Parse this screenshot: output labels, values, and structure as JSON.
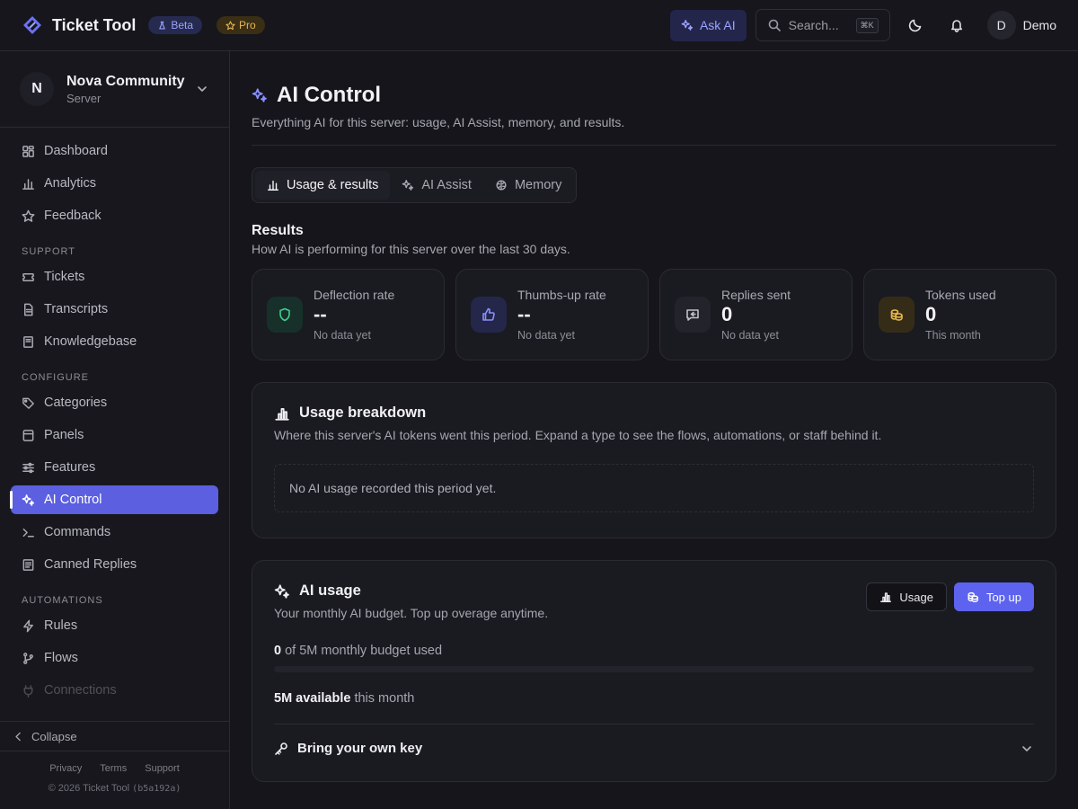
{
  "topbar": {
    "brand": "Ticket Tool",
    "beta_badge": "Beta",
    "pro_badge": "Pro",
    "ask_ai": "Ask AI",
    "search_placeholder": "Search...",
    "search_shortcut": "⌘K",
    "user_initial": "D",
    "user_name": "Demo"
  },
  "sidebar": {
    "server_initial": "N",
    "server_name": "Nova Community",
    "server_type": "Server",
    "items_main": [
      {
        "label": "Dashboard",
        "icon": "dashboard-icon"
      },
      {
        "label": "Analytics",
        "icon": "bar-chart-icon"
      },
      {
        "label": "Feedback",
        "icon": "star-icon"
      }
    ],
    "section_support": "SUPPORT",
    "items_support": [
      {
        "label": "Tickets",
        "icon": "ticket-icon"
      },
      {
        "label": "Transcripts",
        "icon": "document-icon"
      },
      {
        "label": "Knowledgebase",
        "icon": "book-icon"
      }
    ],
    "section_configure": "CONFIGURE",
    "items_configure": [
      {
        "label": "Categories",
        "icon": "tag-icon"
      },
      {
        "label": "Panels",
        "icon": "panel-icon"
      },
      {
        "label": "Features",
        "icon": "sliders-icon"
      },
      {
        "label": "AI Control",
        "icon": "sparkles-icon",
        "active": true
      },
      {
        "label": "Commands",
        "icon": "terminal-icon"
      },
      {
        "label": "Canned Replies",
        "icon": "list-icon"
      }
    ],
    "section_automations": "AUTOMATIONS",
    "items_automations": [
      {
        "label": "Rules",
        "icon": "bolt-icon"
      },
      {
        "label": "Flows",
        "icon": "branch-icon"
      },
      {
        "label": "Connections",
        "icon": "plug-icon"
      }
    ],
    "collapse": "Collapse",
    "footer_links": [
      "Privacy",
      "Terms",
      "Support"
    ],
    "copyright": "© 2026 Ticket Tool",
    "build": "(b5a192a)"
  },
  "page": {
    "title": "AI Control",
    "subtitle": "Everything AI for this server: usage, AI Assist, memory, and results.",
    "tabs": [
      {
        "label": "Usage & results",
        "icon": "bar-chart-icon",
        "active": true
      },
      {
        "label": "AI Assist",
        "icon": "sparkles-icon"
      },
      {
        "label": "Memory",
        "icon": "brain-icon"
      }
    ]
  },
  "results": {
    "title": "Results",
    "subtitle": "How AI is performing for this server over the last 30 days.",
    "stats": [
      {
        "label": "Deflection rate",
        "value": "--",
        "note": "No data yet",
        "icon": "shield-icon",
        "color": "#3ecf8e"
      },
      {
        "label": "Thumbs-up rate",
        "value": "--",
        "note": "No data yet",
        "icon": "thumbs-up-icon",
        "color": "#7c83ff"
      },
      {
        "label": "Replies sent",
        "value": "0",
        "note": "No data yet",
        "icon": "reply-icon",
        "color": "#a0a0aa"
      },
      {
        "label": "Tokens used",
        "value": "0",
        "note": "This month",
        "icon": "coins-icon",
        "color": "#e9b949"
      }
    ]
  },
  "breakdown": {
    "title": "Usage breakdown",
    "subtitle": "Where this server's AI tokens went this period. Expand a type to see the flows, automations, or staff behind it.",
    "empty": "No AI usage recorded this period yet."
  },
  "ai_usage": {
    "title": "AI usage",
    "subtitle": "Your monthly AI budget. Top up overage anytime.",
    "usage_button": "Usage",
    "topup_button": "Top up",
    "used_value": "0",
    "used_text": "of 5M monthly budget used",
    "used_fraction": 0,
    "available_value": "5M available",
    "available_text": "this month",
    "byok": "Bring your own key"
  },
  "colors": {
    "accent": "#5d63ee",
    "background": "#15151b"
  }
}
